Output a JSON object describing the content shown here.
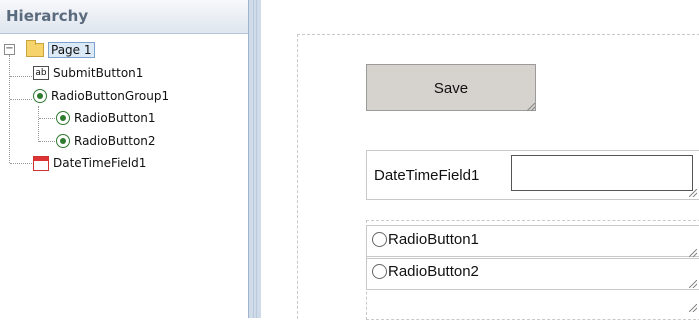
{
  "panel": {
    "title": "Hierarchy"
  },
  "tree": {
    "root": "Page 1",
    "submit": "SubmitButton1",
    "group": "RadioButtonGroup1",
    "radio1": "RadioButton1",
    "radio2": "RadioButton2",
    "datetime": "DateTimeField1",
    "ab_icon_text": "ab",
    "expander_text": "−"
  },
  "design": {
    "save_label": "Save",
    "datetime_label": "DateTimeField1",
    "radio1_label": "RadioButton1",
    "radio2_label": "RadioButton2"
  },
  "icons": [
    "folder-icon",
    "ab-text-icon",
    "radio-icon",
    "calendar-icon"
  ],
  "colors": {
    "panel_header_text": "#5a6b7e",
    "splitter": "#cfdbe9",
    "save_button_bg": "#d6d2ce",
    "selected_node_bg": "#dce9f7"
  }
}
